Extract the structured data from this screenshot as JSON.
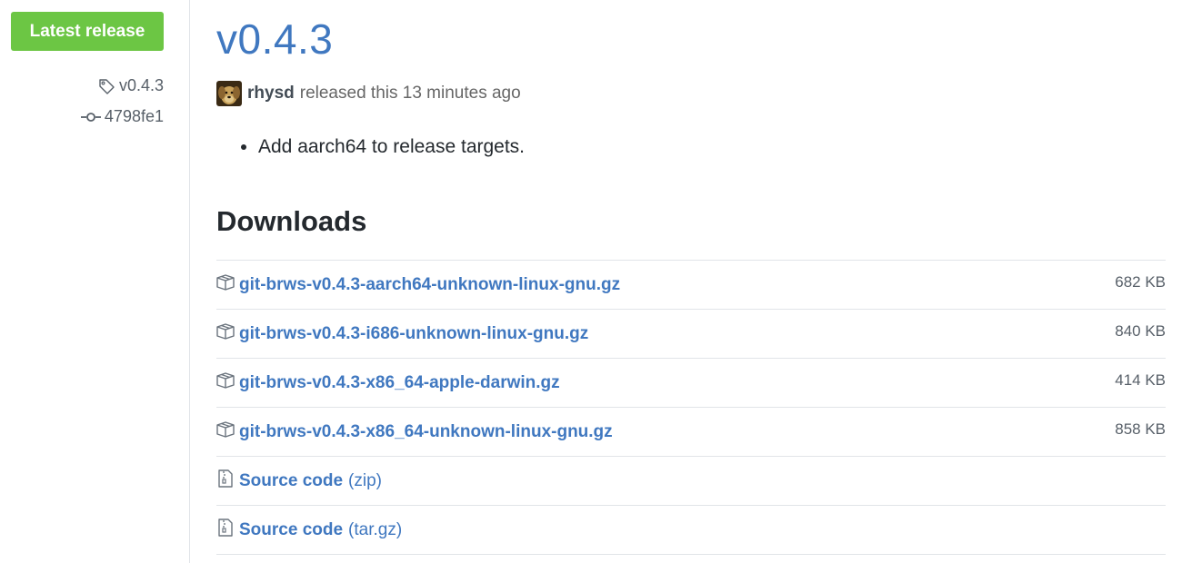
{
  "sidebar": {
    "badge_label": "Latest release",
    "tag": "v0.4.3",
    "commit": "4798fe1",
    "badge_color": "#6cc644"
  },
  "release": {
    "title": "v0.4.3",
    "author": "rhysd",
    "released_text": "released this 13 minutes ago",
    "notes": [
      "Add aarch64 to release targets."
    ]
  },
  "downloads": {
    "heading": "Downloads",
    "assets": [
      {
        "name": "git-brws-v0.4.3-aarch64-unknown-linux-gnu.gz",
        "size": "682 KB",
        "icon": "package-icon"
      },
      {
        "name": "git-brws-v0.4.3-i686-unknown-linux-gnu.gz",
        "size": "840 KB",
        "icon": "package-icon"
      },
      {
        "name": "git-brws-v0.4.3-x86_64-apple-darwin.gz",
        "size": "414 KB",
        "icon": "package-icon"
      },
      {
        "name": "git-brws-v0.4.3-x86_64-unknown-linux-gnu.gz",
        "size": "858 KB",
        "icon": "package-icon"
      }
    ],
    "source": [
      {
        "label": "Source code",
        "format": "(zip)",
        "icon": "file-zip-icon"
      },
      {
        "label": "Source code",
        "format": "(tar.gz)",
        "icon": "file-zip-icon"
      }
    ]
  },
  "colors": {
    "link": "#4078c0",
    "muted": "#586069",
    "border": "#e1e4e8"
  }
}
